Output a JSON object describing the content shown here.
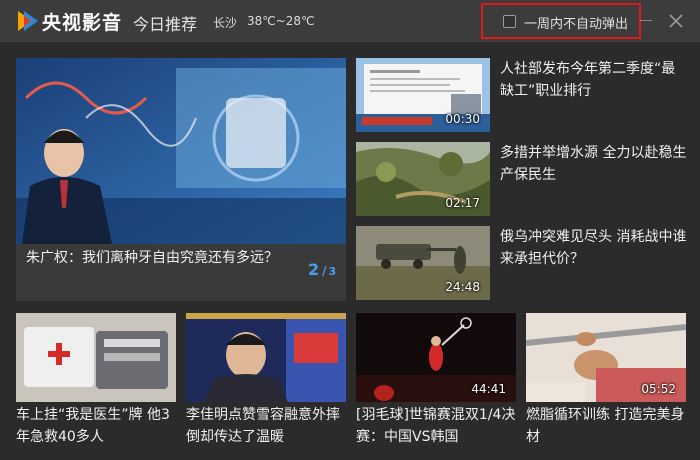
{
  "header": {
    "brand": "央视影音",
    "daily": "今日推荐",
    "weather": {
      "city": "长沙",
      "temp": "38℃~28℃"
    },
    "option_label": "一周内不自动弹出",
    "option_checked": false
  },
  "featured": {
    "title": "朱广权：我们离种牙自由究竟还有多远？",
    "page_current": "2",
    "page_sep": "/",
    "page_total": "3"
  },
  "side_items": [
    {
      "title": "人社部发布今年第二季度“最缺工”职业排行",
      "duration": "00:30"
    },
    {
      "title": "多措并举增水源 全力以赴稳生产保民生",
      "duration": "02:17"
    },
    {
      "title": "俄乌冲突难见尽头 消耗战中谁来承担代价？",
      "duration": "24:48"
    }
  ],
  "bottom_items": [
    {
      "title": "车上挂“我是医生”牌 他3年急救40多人",
      "duration": ""
    },
    {
      "title": "李佳明点赞雪容融意外摔倒却传达了温暖",
      "duration": ""
    },
    {
      "title": "[羽毛球]世锦赛混双1/4决赛：中国VS韩国",
      "duration": "44:41"
    },
    {
      "title": "燃脂循环训练 打造完美身材",
      "duration": "05:52"
    }
  ],
  "colors": {
    "accent": "#4a9eea",
    "highlight": "#e01818",
    "titlebar": "#3c3c3c",
    "background": "#2b2b2b"
  }
}
